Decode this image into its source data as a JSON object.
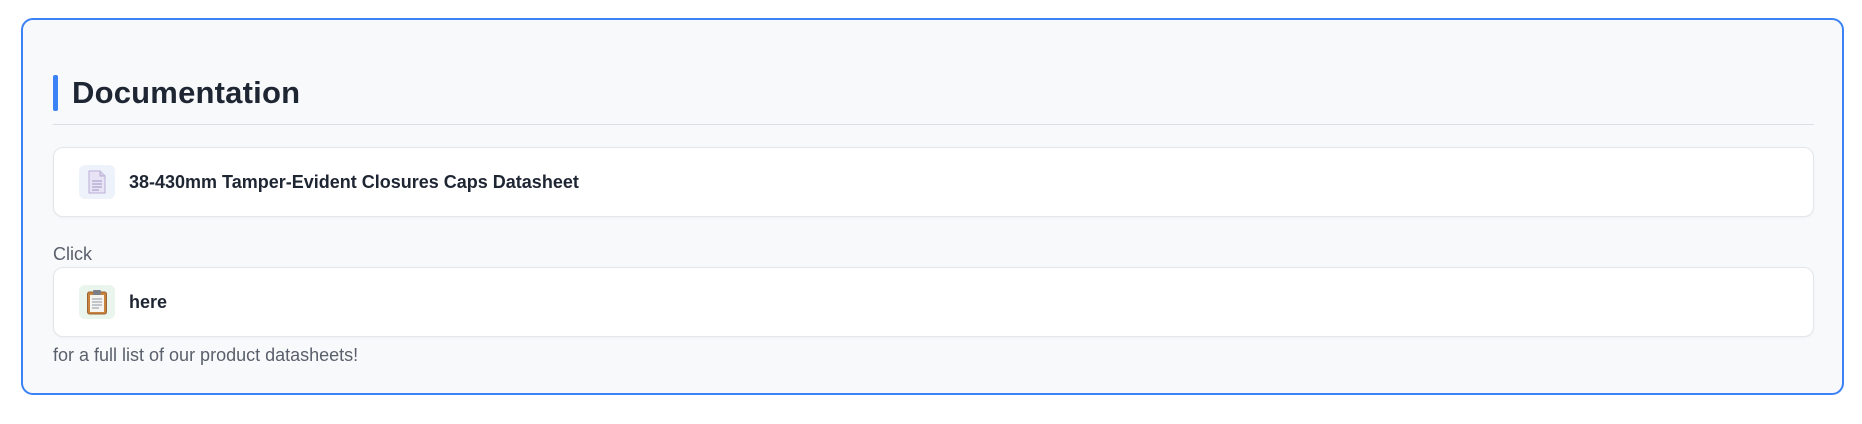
{
  "section": {
    "title": "Documentation"
  },
  "documents": [
    {
      "label": "38-430mm Tamper-Evident Closures Caps Datasheet",
      "icon": "document-icon"
    },
    {
      "label": "here",
      "icon": "clipboard-icon"
    }
  ],
  "text": {
    "click": "Click",
    "tail": "for a full list of our product datasheets!"
  },
  "colors": {
    "accent": "#3b82f6",
    "panel_background": "#f8f9fb",
    "heading_text": "#1f2633",
    "body_text": "#5a606b"
  }
}
